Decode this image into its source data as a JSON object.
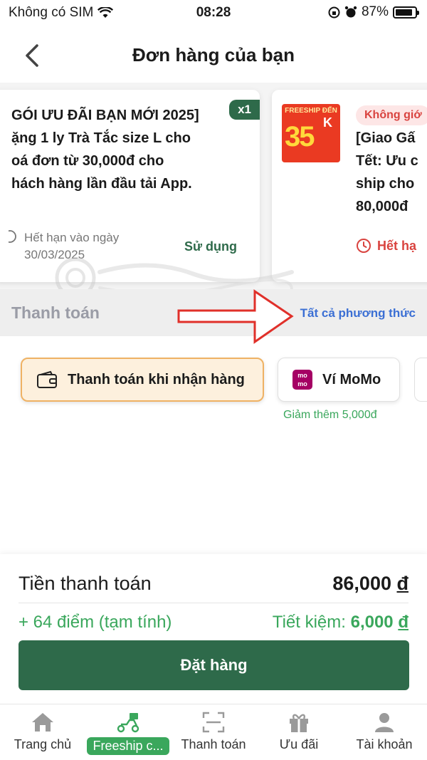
{
  "status_bar": {
    "carrier": "Không có SIM",
    "time": "08:28",
    "battery": "87%",
    "battery_level": 0.87
  },
  "header": {
    "title": "Đơn hàng của bạn"
  },
  "vouchers": [
    {
      "quantity": "x1",
      "text": "GÓI ƯU ĐÃI BẠN MỚI 2025]\nặng 1 ly Trà Tắc size L cho\noá đơn từ 30,000đ cho\nhách hàng lần đầu tải App.",
      "expiry": "Hết hạn vào ngày 30/03/2025",
      "action": "Sử dụng"
    },
    {
      "image_top": "FREESHIP ĐẾN",
      "image_value": "35",
      "image_unit": "K",
      "badge": "Không giớ",
      "text": "[Giao Gấ\nTết: Ưu c\nship cho\n80,000đ",
      "expiry": "Hết hạ"
    }
  ],
  "payment": {
    "title": "Thanh toán",
    "all_methods": "Tất cả phương thức",
    "options": [
      {
        "label": "Thanh toán khi nhận hàng",
        "icon": "wallet-icon",
        "selected": true
      },
      {
        "label": "Ví MoMo",
        "icon": "momo-logo",
        "logo_text": "mo mo",
        "note": "Giảm thêm 5,000đ"
      }
    ]
  },
  "summary": {
    "total_label": "Tiền thanh toán",
    "total_value": "86,000",
    "currency": "đ",
    "points": "+ 64 điểm (tạm tính)",
    "savings_label": "Tiết kiệm:",
    "savings_value": "6,000",
    "order_button": "Đặt hàng"
  },
  "tabs": [
    {
      "label": "Trang chủ",
      "icon": "home-icon"
    },
    {
      "label": "Freeship c...",
      "icon": "delivery-scooter-icon",
      "active": true
    },
    {
      "label": "Thanh toán",
      "icon": "scan-icon"
    },
    {
      "label": "Ưu đãi",
      "icon": "gift-icon"
    },
    {
      "label": "Tài khoản",
      "icon": "user-icon"
    }
  ],
  "colors": {
    "primary": "#2e6a4a",
    "accent_green": "#3aa75c",
    "link_blue": "#3b6fd4",
    "danger": "#d9433f",
    "selected_bg": "#fdf0dd",
    "selected_border": "#efb264"
  }
}
